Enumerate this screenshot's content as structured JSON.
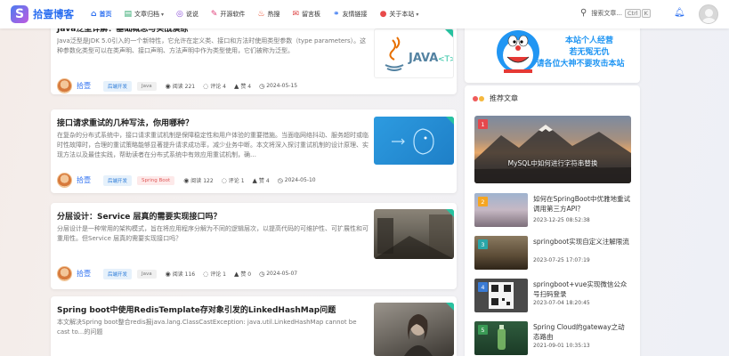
{
  "site": {
    "logo_glyph": "S",
    "name": "拾壹博客"
  },
  "nav": [
    {
      "icon": "home-icon",
      "glyph": "⌂",
      "label": "首页",
      "caret": false
    },
    {
      "icon": "archive-icon",
      "glyph": "▤",
      "label": "文章归档",
      "caret": true
    },
    {
      "icon": "talk-icon",
      "glyph": "◎",
      "label": "说说",
      "caret": false
    },
    {
      "icon": "tools-icon",
      "glyph": "✎",
      "label": "开源软件",
      "caret": false
    },
    {
      "icon": "fire-icon",
      "glyph": "♨",
      "label": "热搜",
      "caret": false
    },
    {
      "icon": "message-icon",
      "glyph": "✉",
      "label": "留言板",
      "caret": false
    },
    {
      "icon": "link-icon",
      "glyph": "⚭",
      "label": "友情链接",
      "caret": false
    },
    {
      "icon": "about-icon",
      "glyph": "●",
      "label": "关于本站",
      "caret": true
    }
  ],
  "search": {
    "placeholder": "搜索文章...",
    "key1": "Ctrl",
    "key2": "K"
  },
  "articles": [
    {
      "title": "Java泛型详解：基础概念与实战演练",
      "excerpt": "Java泛型是JDK 5.0引入的一个新特性，它允许在定义类、接口和方法时使用类型参数（type parameters）。这种参数化类型可以在类声明、接口声明、方法声明中作为类型使用，它们被称为泛型。",
      "author": "拾壹",
      "tags": [
        "后端开发",
        "Java"
      ],
      "views": "阅读 221",
      "comments": "评论 4",
      "likes": "赞 4",
      "date": "2024-05-15"
    },
    {
      "title": "接口请求重试的几种写法，你用哪种？",
      "excerpt": "在复杂的分布式系统中，接口请求重试机制是保障稳定性和用户体验的重要措施。当面临网络抖动、服务超时或临时性故障时，合理的重试策略能够显著提升请求成功率，减少业务中断。本文将深入探讨重试机制的设计原理、实现方法以及最佳实践，帮助读者在分布式系统中有效应用重试机制，确…",
      "author": "拾壹",
      "tags": [
        "后端开发",
        "Spring Boot"
      ],
      "views": "阅读 122",
      "comments": "评论 1",
      "likes": "赞 4",
      "date": "2024-05-10"
    },
    {
      "title": "分层设计：Service 层真的需要实现接口吗？",
      "excerpt": "分层设计是一种常用的架构模式，旨在将应用程序分解为不同的逻辑层次，以提高代码的可维护性、可扩展性和可重用性。但Service 层真的需要实现接口吗？",
      "author": "拾壹",
      "tags": [
        "后端开发",
        "Java"
      ],
      "views": "阅读 116",
      "comments": "评论 1",
      "likes": "赞 0",
      "date": "2024-05-07"
    },
    {
      "title": "Spring boot中使用RedisTemplate存对象引发的LinkedHashMap问题",
      "excerpt": "本文解决Spring boot整合redis报java.lang.ClassCastException: java.util.LinkedHashMap cannot be cast to...的问题",
      "author": "",
      "tags": [],
      "views": "",
      "comments": "",
      "likes": "",
      "date": ""
    }
  ],
  "banner": {
    "line1": "本站个人经营",
    "line2": "若无冤无仇",
    "line3": "请各位大神不要攻击本站"
  },
  "recommend": {
    "heading": "推荐文章",
    "main": {
      "rank": "1",
      "title": "MySQL中如何进行字符串替换"
    },
    "items": [
      {
        "rank": "2",
        "title": "如何在SpringBoot中优雅地重试调用第三方API？",
        "date": "2023-12-25 08:52:38"
      },
      {
        "rank": "3",
        "title": "springboot实现自定义注解限流",
        "date": "2023-07-25 17:07:19"
      },
      {
        "rank": "4",
        "title": "springboot+vue实现微信公众号扫码登录",
        "date": "2023-07-04 18:20:45"
      },
      {
        "rank": "5",
        "title": "Spring Cloud的gateway之动态路由",
        "date": "2021-09-01 10:35:13"
      }
    ]
  },
  "colors": {
    "primary": "#2a6ef0",
    "accent_green": "#27c2a0",
    "rank1": "#e5484d",
    "rank2": "#f5a623",
    "rank3": "#2aa6a8"
  }
}
